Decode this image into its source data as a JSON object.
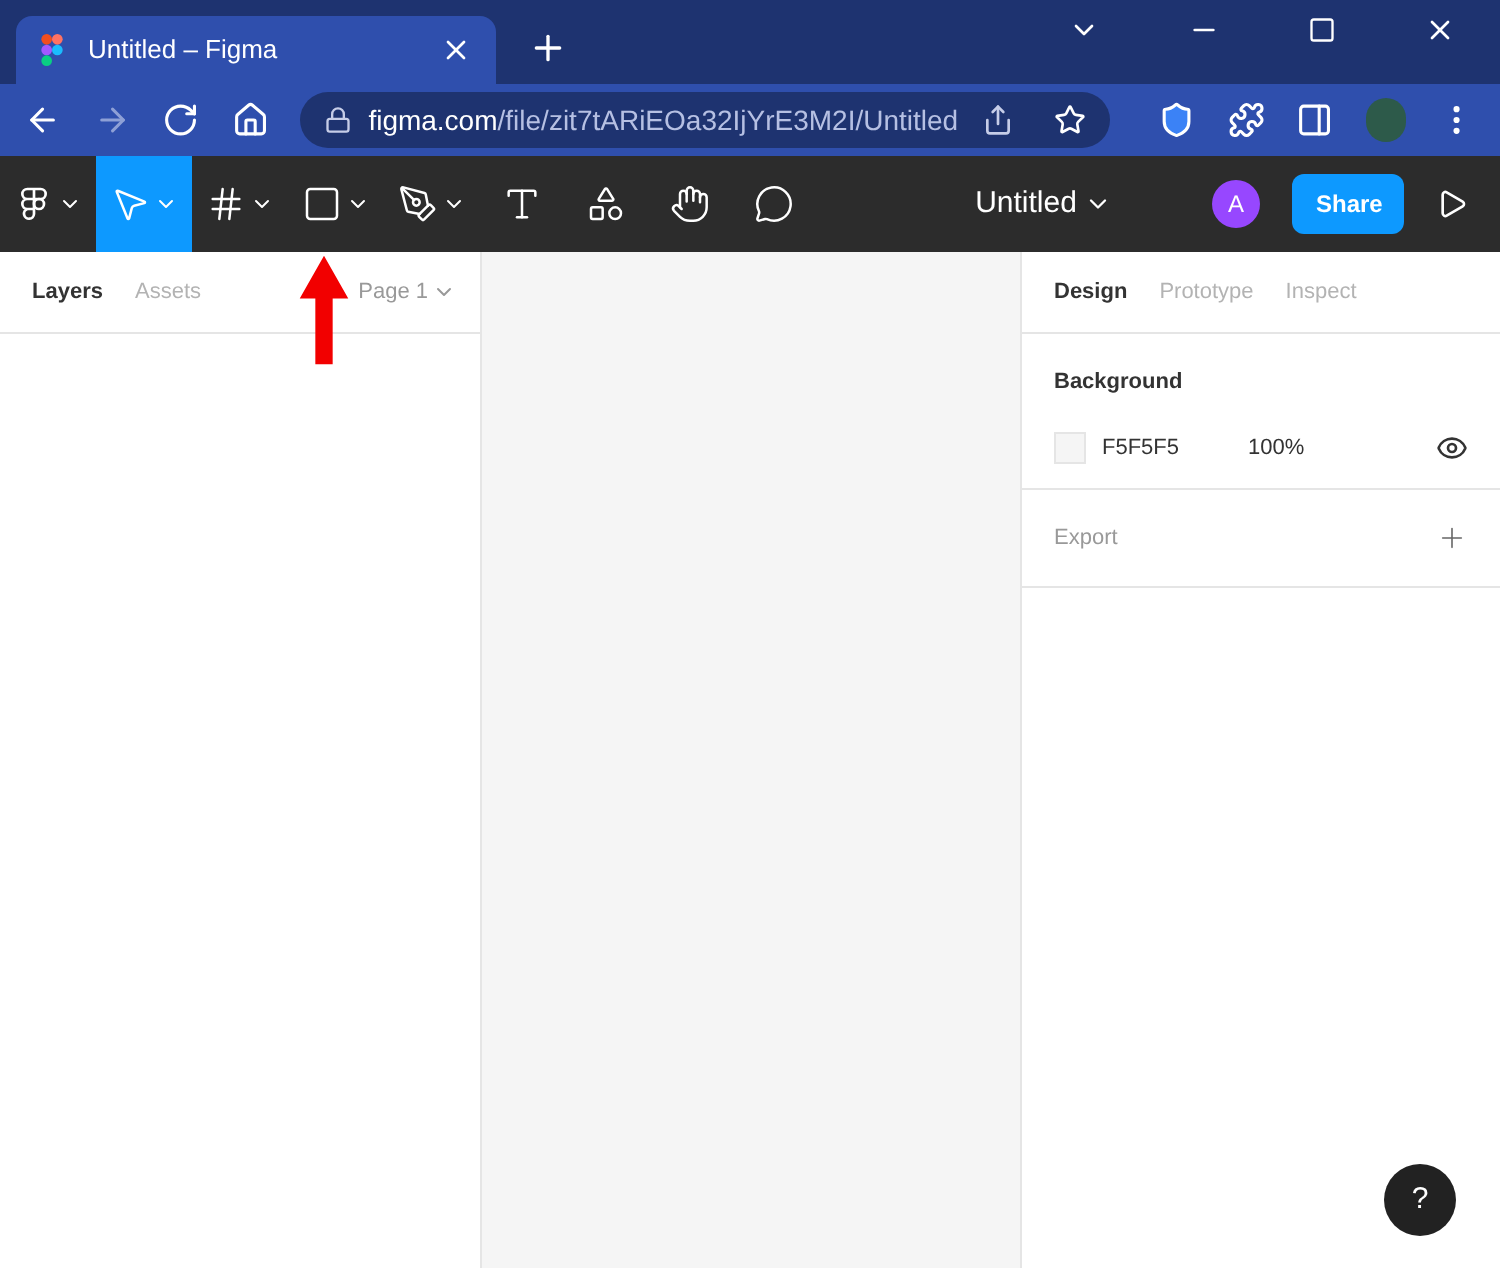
{
  "browser": {
    "tab_title": "Untitled – Figma",
    "url_host": "figma.com",
    "url_path": "/file/zit7tARiEOa32IjYrE3M2I/Untitled"
  },
  "toolbar": {
    "tools": [
      {
        "kind": "menu",
        "selected": false,
        "caret": true
      },
      {
        "kind": "move",
        "selected": true,
        "caret": true
      },
      {
        "kind": "frame",
        "selected": false,
        "caret": true
      },
      {
        "kind": "rectangle",
        "selected": false,
        "caret": true
      },
      {
        "kind": "pen",
        "selected": false,
        "caret": true
      },
      {
        "kind": "text",
        "selected": false,
        "caret": false
      },
      {
        "kind": "components",
        "selected": false,
        "caret": false
      },
      {
        "kind": "hand",
        "selected": false,
        "caret": false
      },
      {
        "kind": "comment",
        "selected": false,
        "caret": false
      }
    ],
    "file_name": "Untitled",
    "avatar": "A",
    "share": "Share"
  },
  "left_panel": {
    "tabs": [
      {
        "label": "Layers",
        "selected": true
      },
      {
        "label": "Assets",
        "selected": false
      }
    ],
    "page": "Page 1"
  },
  "right_panel": {
    "tabs": [
      {
        "label": "Design",
        "selected": true
      },
      {
        "label": "Prototype",
        "selected": false
      },
      {
        "label": "Inspect",
        "selected": false
      }
    ],
    "background": {
      "title": "Background",
      "color": "#f5f5f5",
      "hex": "F5F5F5",
      "opacity": "100%"
    },
    "export": "Export"
  },
  "help": "?"
}
